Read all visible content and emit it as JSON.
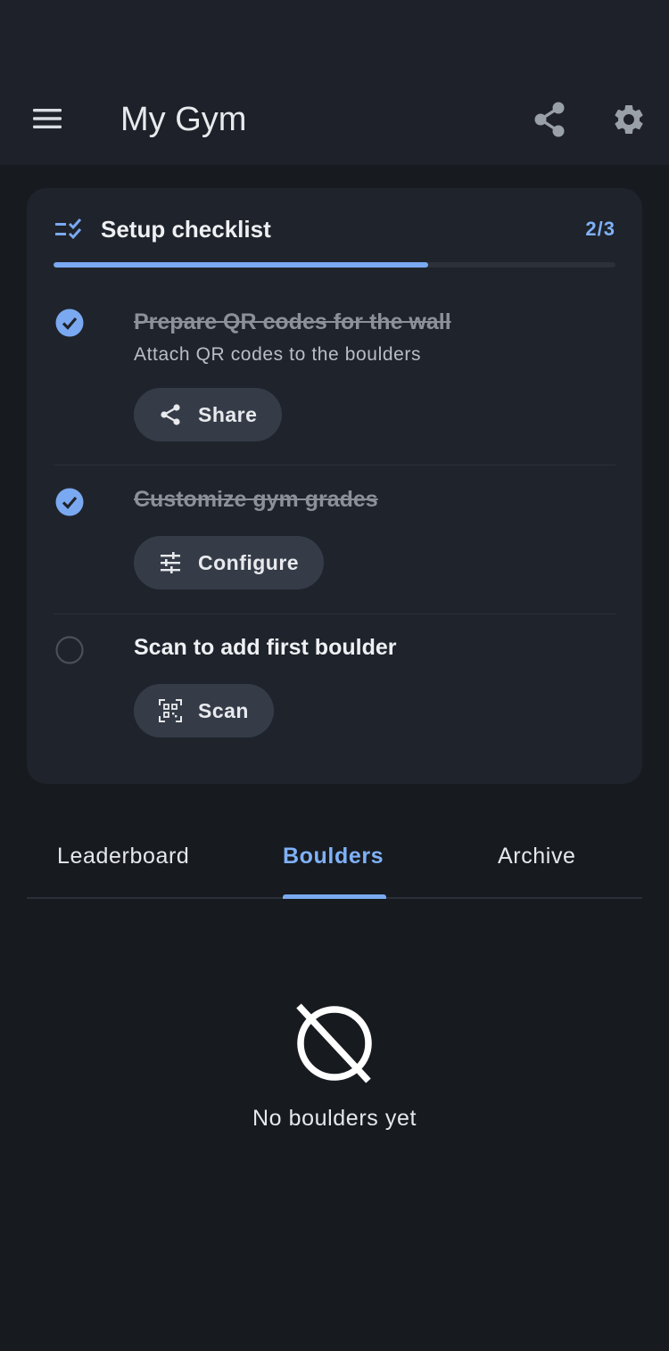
{
  "app_bar": {
    "title": "My Gym",
    "menu_icon": "menu-icon",
    "share_icon": "share-icon",
    "settings_icon": "gear-icon"
  },
  "checklist": {
    "title": "Setup checklist",
    "count": "2/3",
    "progress": 0.667,
    "icon": "checklist-icon",
    "items": [
      {
        "title": "Prepare QR codes for the wall",
        "subtitle": "Attach QR codes to the boulders",
        "done": true,
        "action_label": "Share",
        "action_icon": "share-icon"
      },
      {
        "title": "Customize gym grades",
        "done": true,
        "action_label": "Configure",
        "action_icon": "tune-icon"
      },
      {
        "title": "Scan to add first boulder",
        "done": false,
        "action_label": "Scan",
        "action_icon": "qr-scan-icon"
      }
    ]
  },
  "tabs": {
    "items": [
      "Leaderboard",
      "Boulders",
      "Archive"
    ],
    "active": "Boulders"
  },
  "empty_state": {
    "icon": "block-icon",
    "text": "No boulders yet"
  },
  "colors": {
    "accent": "#7aa9f1",
    "background": "#171a1f",
    "surface": "#1f232b",
    "app_bar": "#1e2129",
    "pill": "#353c48"
  }
}
